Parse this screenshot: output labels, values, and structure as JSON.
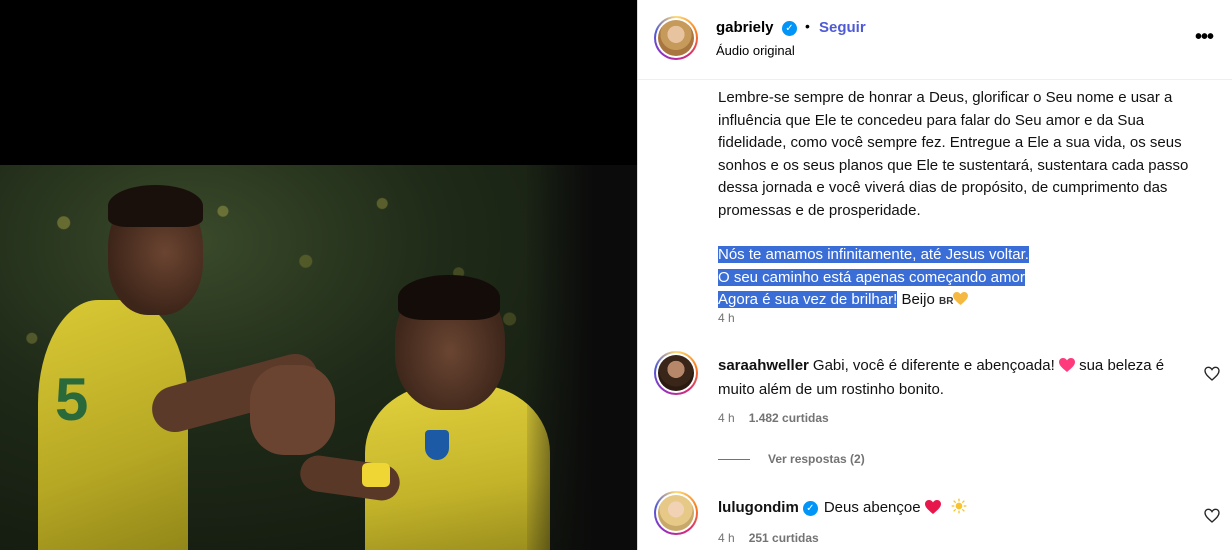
{
  "post": {
    "username": "gabriely",
    "verified_mark": "✓",
    "separator": "•",
    "follow_label": "Seguir",
    "audio_label": "Áudio original",
    "more_label": "•••",
    "caption_paragraph": "Lembre-se sempre de honrar a Deus, glorificar o Seu nome e usar a influência que Ele te concedeu para falar do Seu amor e da Sua fidelidade, como você sempre fez. Entregue a Ele a sua vida, os seus sonhos e os seus planos que Ele te sustentará, sustentara cada passo dessa jornada e você viverá dias de propósito, de cumprimento das promessas e de prosperidade.",
    "highlight_line_1": "Nós te amamos infinitamente, até Jesus voltar.",
    "highlight_line_2": "O seu caminho está apenas começando amor",
    "highlight_line_3": "Agora é sua vez de brilhar!",
    "caption_tail": " Beijo ",
    "flag_text": "BR",
    "time": "4 h"
  },
  "comments": [
    {
      "username": "saraahweller",
      "text_before": "Gabi, você é diferente e abençoada! ",
      "text_after": " sua beleza é muito além de um rostinho bonito.",
      "time": "4 h",
      "likes": "1.482 curtidas",
      "replies_label": "Ver respostas (2)"
    },
    {
      "username": "lulugondim",
      "verified_mark": "✓",
      "text": "Deus abençoe ",
      "time": "4 h",
      "likes": "251 curtidas"
    }
  ],
  "icons": {
    "heart_filled_color": "#ff3040",
    "heart_yellow_color": "#f5b841",
    "sun_color": "#f7c32e"
  },
  "colors": {
    "accent": "#4f5bd5",
    "verified": "#0095f6",
    "highlight": "#3b6dd6"
  }
}
